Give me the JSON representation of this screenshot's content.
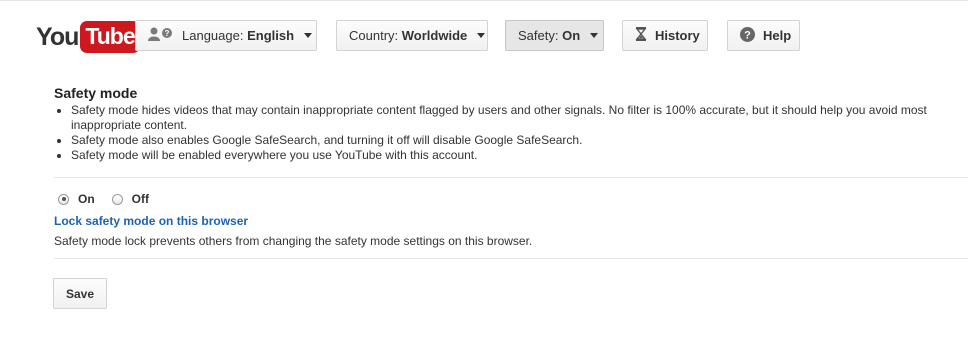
{
  "logo": {
    "you": "You",
    "tube": "Tube"
  },
  "toolbar": {
    "language_prefix": "Language:",
    "language_value": "English",
    "country_prefix": "Country:",
    "country_value": "Worldwide",
    "safety_prefix": "Safety:",
    "safety_value": "On",
    "history_label": "History",
    "help_label": "Help"
  },
  "safety": {
    "title": "Safety mode",
    "bullets": [
      "Safety mode hides videos that may contain inappropriate content flagged by users and other signals. No filter is 100% accurate, but it should help you avoid most inappropriate content.",
      "Safety mode also enables Google SafeSearch, and turning it off will disable Google SafeSearch.",
      "Safety mode will be enabled everywhere you use YouTube with this account."
    ],
    "on_label": "On",
    "off_label": "Off",
    "selected": "On",
    "lock_link": "Lock safety mode on this browser",
    "lock_desc": "Safety mode lock prevents others from changing the safety mode settings on this browser.",
    "save_label": "Save"
  },
  "colors": {
    "brand_red": "#cc181e",
    "link_blue": "#1b63b8"
  },
  "icons": [
    "people-icon",
    "hourglass-icon",
    "help-icon",
    "dropdown-caret-icon"
  ]
}
